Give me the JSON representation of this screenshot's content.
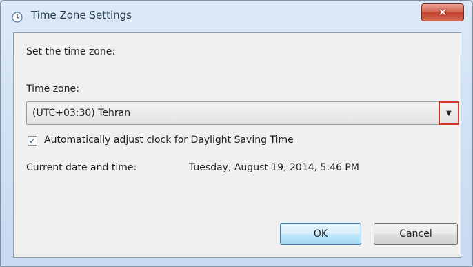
{
  "window": {
    "title": "Time Zone Settings",
    "close_glyph": "✕"
  },
  "dialog": {
    "set_label": "Set the time zone:",
    "timezone_label": "Time zone:",
    "timezone_value": "(UTC+03:30) Tehran",
    "dropdown_glyph": "▼",
    "dst_checked": true,
    "dst_check_glyph": "✓",
    "dst_label": "Automatically adjust clock for Daylight Saving Time",
    "current_label": "Current date and time:",
    "current_value": "Tuesday, August 19, 2014, 5:46 PM",
    "ok_label": "OK",
    "cancel_label": "Cancel"
  },
  "icons": {
    "title": "clock-globe-icon",
    "close": "close-icon",
    "dropdown": "chevron-down-icon",
    "checkbox": "check-icon"
  },
  "colors": {
    "frame": "#c7daf0",
    "close_button": "#c2402b",
    "dropdown_highlight": "#d03a2a",
    "ok_button_border": "#3c7fb1"
  }
}
